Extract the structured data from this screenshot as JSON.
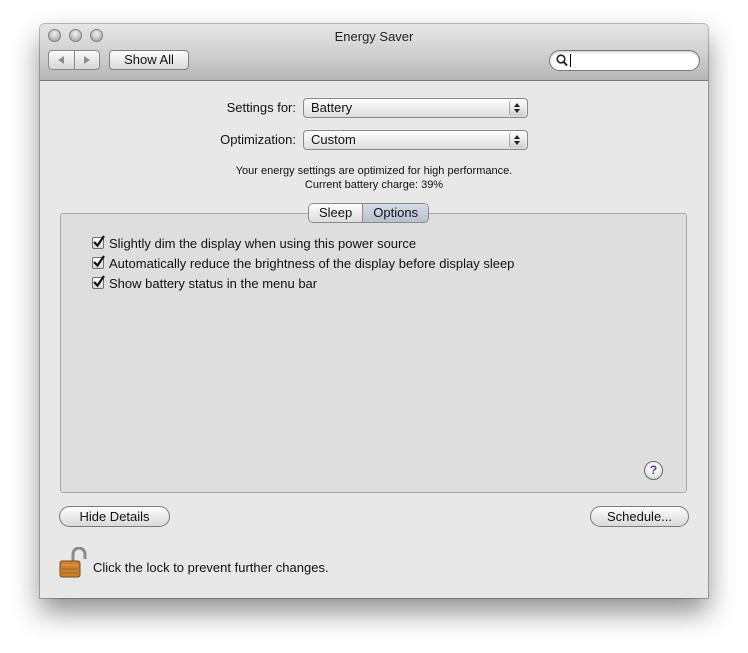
{
  "window": {
    "title": "Energy Saver"
  },
  "toolbar": {
    "show_all_label": "Show All",
    "search_value": ""
  },
  "settings_for": {
    "label": "Settings for:",
    "value": "Battery"
  },
  "optimization": {
    "label": "Optimization:",
    "value": "Custom"
  },
  "status": {
    "line1": "Your energy settings are optimized for high performance.",
    "line2": "Current battery charge: 39%"
  },
  "tabs": [
    {
      "label": "Sleep",
      "selected": false
    },
    {
      "label": "Options",
      "selected": true
    }
  ],
  "options": [
    {
      "label": "Slightly dim the display when using this power source",
      "checked": true
    },
    {
      "label": "Automatically reduce the brightness of the display before display sleep",
      "checked": true
    },
    {
      "label": "Show battery status in the menu bar",
      "checked": true
    }
  ],
  "help_label": "?",
  "buttons": {
    "hide_details": "Hide Details",
    "schedule": "Schedule..."
  },
  "lock": {
    "text": "Click the lock to prevent further changes."
  }
}
